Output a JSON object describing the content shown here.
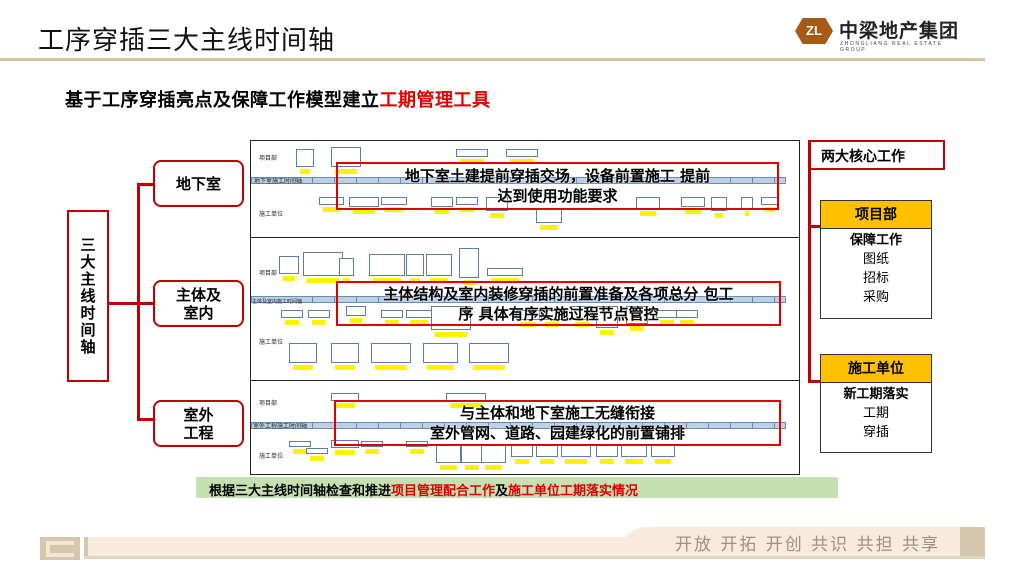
{
  "header": {
    "title": "工序穿插三大主线时间轴",
    "logo_mark": "ZL",
    "logo_cn": "中梁地产集团",
    "logo_en": "ZHONGLIANG REAL ESTATE GROUP"
  },
  "subtitle": {
    "prefix": "基于工序穿插亮点及保障工作模型建立",
    "highlight": "工期管理工具"
  },
  "tree": {
    "root": "三大主线时间轴",
    "branches": [
      "地下室",
      "主体及室内",
      "室外工程"
    ]
  },
  "timelines": [
    {
      "row_labels": [
        "项目部",
        "地下室施工时间轴",
        "施工单位"
      ],
      "overlay": [
        "地下室土建提前穿插交场，设备前置施工 提前",
        "达到使用功能要求"
      ]
    },
    {
      "row_labels": [
        "项目部",
        "主体及室内施工时间轴",
        "施工单位"
      ],
      "overlay": [
        "主体结构及室内装修穿插的前置准备及各项总分 包工",
        "序 具体有序实施过程节点管控"
      ]
    },
    {
      "row_labels": [
        "项目部",
        "室外工程施工时间轴",
        "施工单位"
      ],
      "overlay": [
        "与主体和地下室施工无缝衔接",
        "室外管网、道路、园建绿化的前置铺排"
      ]
    }
  ],
  "core": {
    "title": "两大核心工作",
    "groups": [
      {
        "header": "项目部",
        "lead": "保障工作",
        "items": [
          "图纸",
          "招标",
          "采购"
        ]
      },
      {
        "header": "施工单位",
        "lead": "新工期落实",
        "items": [
          "工期",
          "穿插"
        ]
      }
    ]
  },
  "summary": {
    "part1": "根据三大主线时间轴检查和推进",
    "part2": "项目管理配合工作",
    "part3": "及",
    "part4": "施工单位工期落实情况"
  },
  "footer": {
    "slogan": "开放 开拓 开创 共识 共担 共享"
  },
  "colors": {
    "accent_red": "#c00000",
    "highlight_red": "#e00000",
    "amber": "#ffc000",
    "green": "#c6e0b4",
    "beige": "#d6c6a8"
  }
}
